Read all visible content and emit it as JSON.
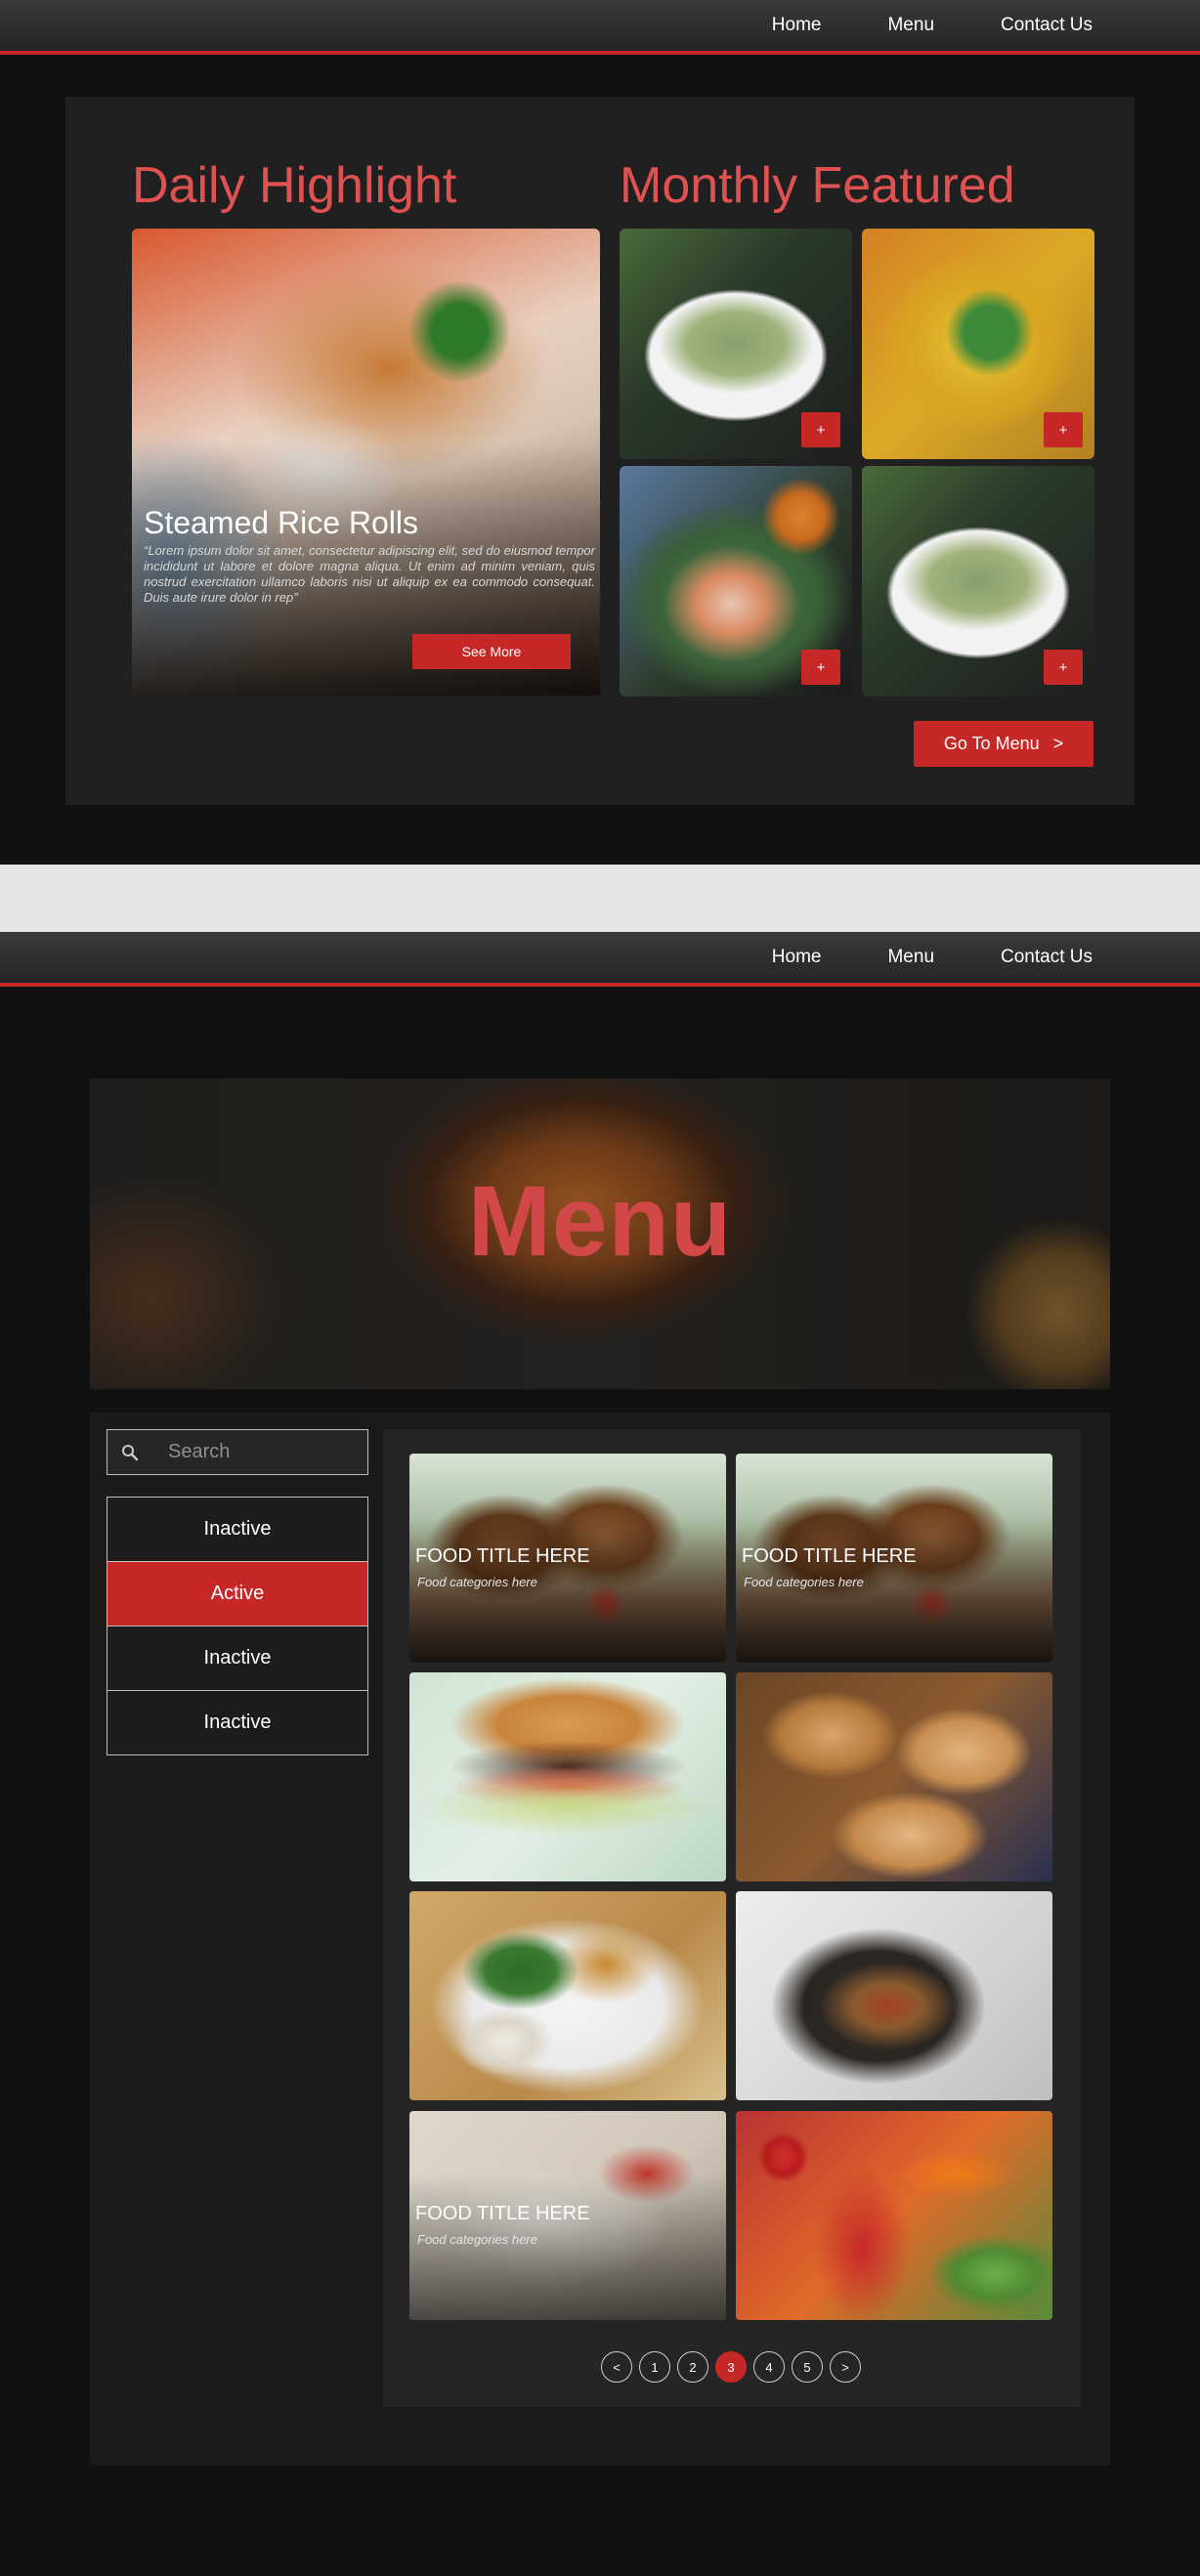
{
  "nav": {
    "home": "Home",
    "menu": "Menu",
    "contact": "Contact Us"
  },
  "featured": {
    "daily_title": "Daily Highlight",
    "monthly_title": "Monthly Featured",
    "daily_dish": {
      "name": "Steamed Rice Rolls",
      "description": "“Lorem ipsum dolor sit amet, consectetur adipiscing elit, sed do eiusmod tempor incididunt ut labore et dolore magna aliqua. Ut enim ad minim veniam, quis nostrud exercitation ullamco laboris nisi ut aliquip ex ea commodo consequat. Duis aute irure dolor in rep”",
      "button": "See More"
    },
    "tile_button": "+",
    "go_menu": "Go To Menu",
    "go_menu_chevron": ">"
  },
  "menu_hero": {
    "title": "Menu"
  },
  "search": {
    "placeholder": "Search"
  },
  "categories": [
    {
      "label": "Inactive",
      "state": "inactive"
    },
    {
      "label": "Active",
      "state": "active"
    },
    {
      "label": "Inactive",
      "state": "inactive"
    },
    {
      "label": "Inactive",
      "state": "inactive"
    }
  ],
  "food_tiles": [
    {
      "title": "FOOD TITLE HERE",
      "category": "Food categories here"
    },
    {
      "title": "FOOD TITLE HERE",
      "category": "Food categories here"
    },
    {
      "title": "FOOD TITLE HERE",
      "category": "Food categories here"
    }
  ],
  "pagination": {
    "prev": "<",
    "pages": [
      "1",
      "2",
      "3",
      "4",
      "5"
    ],
    "current": "3",
    "next": ">"
  },
  "colors": {
    "accent": "#c62828",
    "heading": "#e05252",
    "background": "#111111",
    "panel": "#202020"
  },
  "icons": {
    "search": "search-icon",
    "plus": "plus-icon"
  }
}
